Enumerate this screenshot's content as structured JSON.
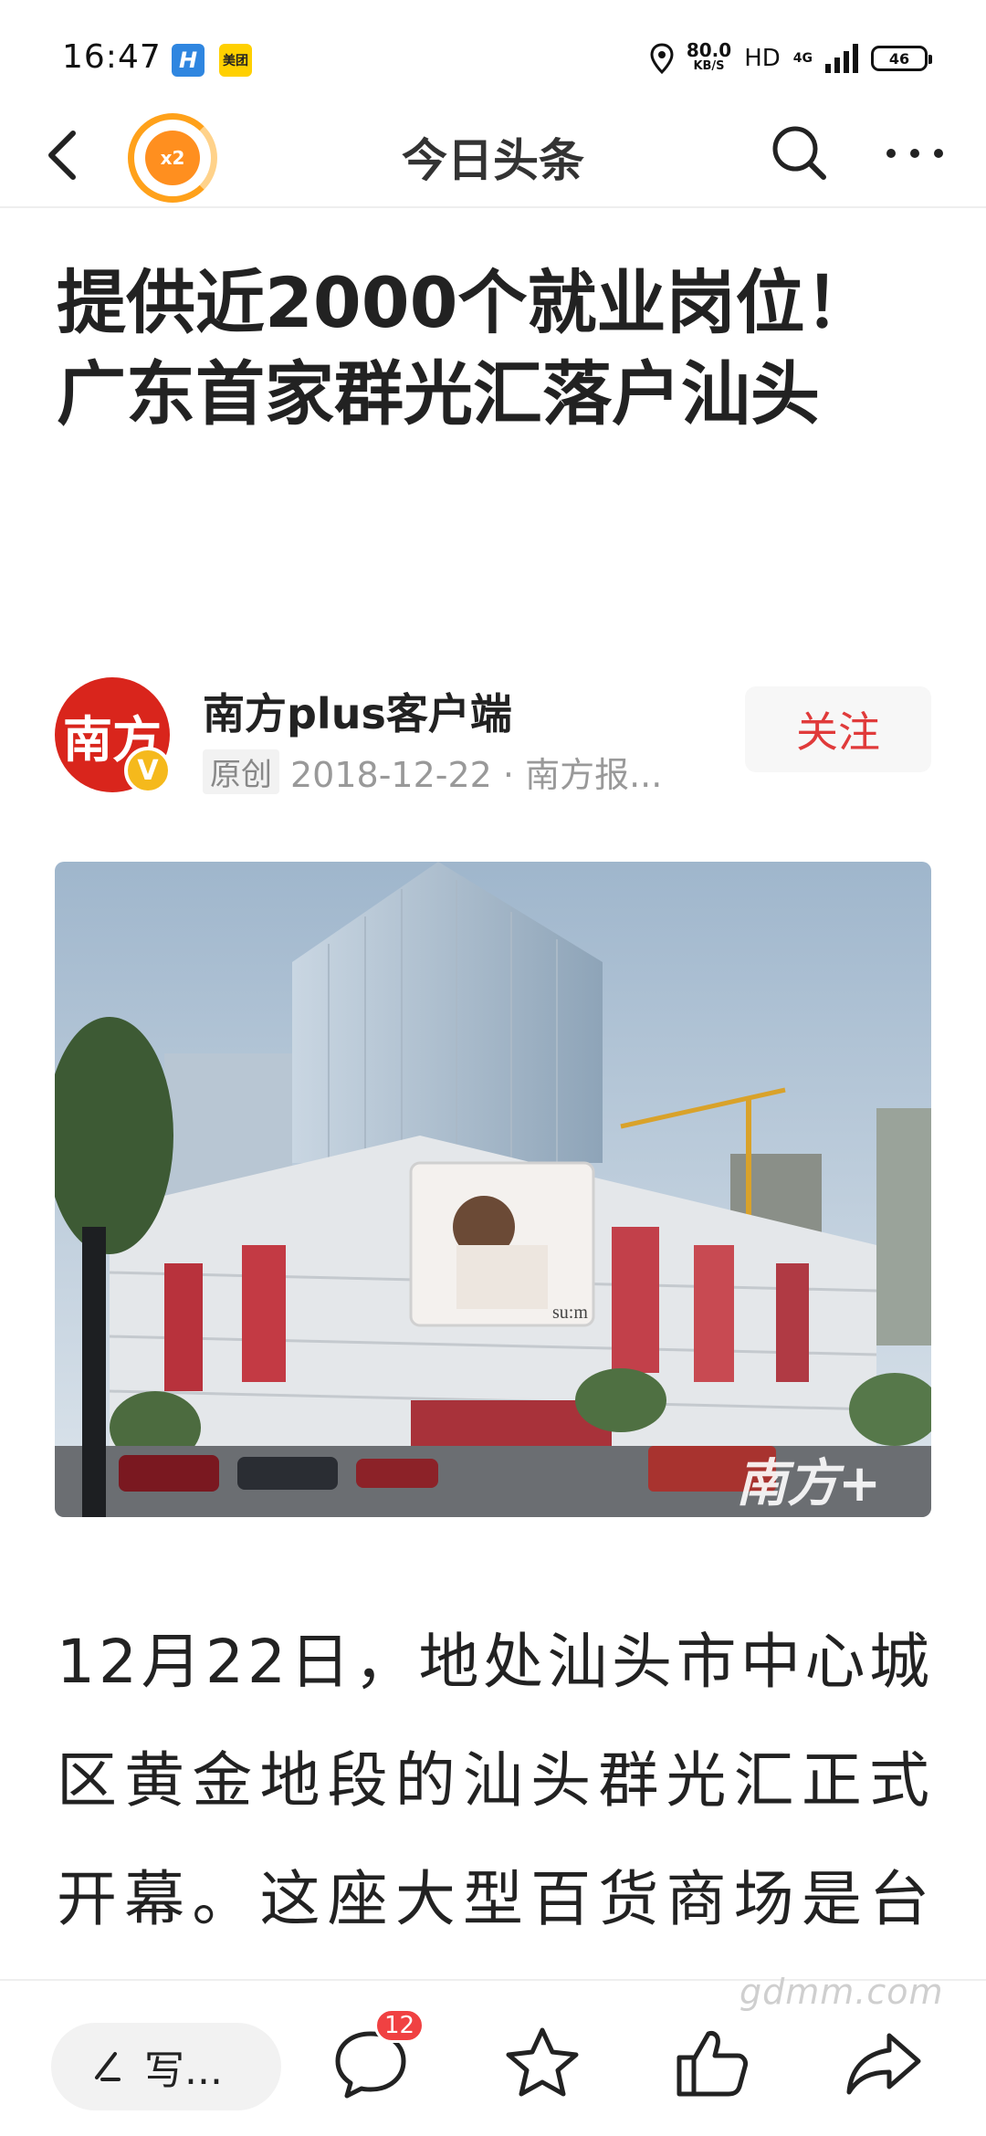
{
  "status_bar": {
    "time": "16:47",
    "app_icons": [
      "browser-h-icon",
      "meituan-icon"
    ],
    "meituan_label": "美团",
    "net_speed_value": "80.0",
    "net_speed_unit": "KB/S",
    "hd": "HD",
    "signal": "4G",
    "battery": "46"
  },
  "nav": {
    "title": "今日头条",
    "coin_label": "x2",
    "icons": [
      "back-icon",
      "gold-coin-icon",
      "search-icon",
      "more-icon"
    ]
  },
  "article": {
    "headline": "提供近2000个就业岗位！广东首家群光汇落户汕头",
    "author": {
      "avatar_text": "南方",
      "verified_mark": "V",
      "name": "南方plus客户端",
      "original_tag": "原创",
      "date_source": "2018-12-22 · 南方报..."
    },
    "follow_label": "关注",
    "photo": {
      "screen_text": "su:m",
      "watermark_text": "南方+"
    },
    "body": "12月22日，地处汕头市中心城区黄金地段的汕头群光汇正式开幕。这座大型百货商场是台湾上市公司茂万集团"
  },
  "bottom_bar": {
    "write_label": "写...",
    "comment_count": "12",
    "icons": [
      "pen-icon",
      "comment-icon",
      "star-icon",
      "thumbs-up-icon",
      "share-icon"
    ]
  },
  "watermark": "gdmm.com",
  "colors": {
    "accent_red": "#e03a3a",
    "badge_red": "#f04142",
    "coin_orange": "#ffa11a",
    "avatar_red": "#d9251c"
  }
}
